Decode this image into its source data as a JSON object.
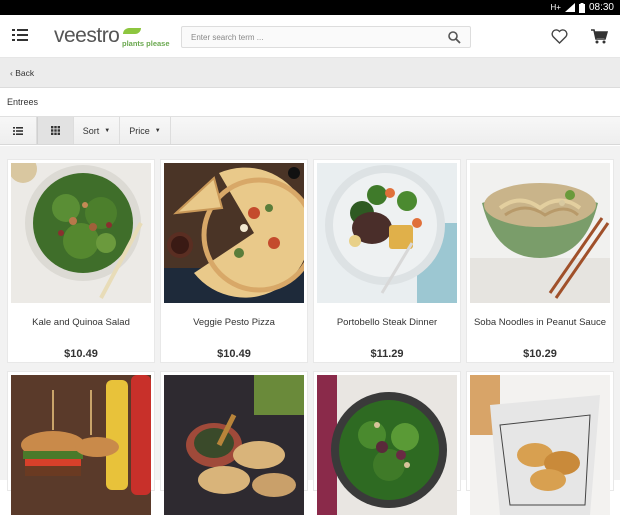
{
  "status_bar": {
    "network": "H+",
    "time": "08:30"
  },
  "header": {
    "logo_main": "veestro",
    "logo_sub": "plants please",
    "search_placeholder": "Enter search term ..."
  },
  "nav": {
    "back_label": "Back"
  },
  "section": {
    "title": "Entrees"
  },
  "toolbar": {
    "sort_label": "Sort",
    "price_label": "Price"
  },
  "products": [
    {
      "name": "Kale and Quinoa Salad",
      "price": "$10.49"
    },
    {
      "name": "Veggie Pesto Pizza",
      "price": "$10.49"
    },
    {
      "name": "Portobello Steak Dinner",
      "price": "$11.29"
    },
    {
      "name": "Soba Noodles in Peanut Sauce",
      "price": "$10.29"
    },
    {
      "name": "",
      "price": ""
    },
    {
      "name": "",
      "price": ""
    },
    {
      "name": "",
      "price": ""
    },
    {
      "name": "",
      "price": ""
    }
  ],
  "colors": {
    "brand_green": "#8dc63f",
    "text": "#333333"
  }
}
